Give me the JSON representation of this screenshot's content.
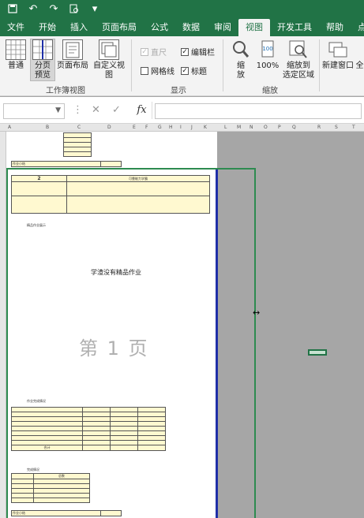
{
  "titlebar": {
    "save_icon": "save-icon",
    "undo_icon": "undo-icon",
    "redo_icon": "redo-icon",
    "preview_icon": "print-preview-icon",
    "customize": "▾"
  },
  "tabs": [
    "文件",
    "开始",
    "插入",
    "页面布局",
    "公式",
    "数据",
    "审阅",
    "视图",
    "开发工具",
    "帮助",
    "点"
  ],
  "active_tab": "视图",
  "ribbon": {
    "workbook_views": {
      "normal": "普通",
      "page_break_line1": "分页",
      "page_break_line2": "预览",
      "page_layout": "页面布局",
      "custom_view": "自定义视图",
      "group_label": "工作簿视图"
    },
    "show": {
      "ruler": "直尺",
      "formula_bar": "编辑栏",
      "gridlines": "网格线",
      "headings": "标题",
      "group_label": "显示"
    },
    "zoom": {
      "zoom_line1": "缩",
      "zoom_line2": "放",
      "zoom_100": "100%",
      "zoom_sel_line1": "缩放到",
      "zoom_sel_line2": "选定区域",
      "group_label": "缩放"
    },
    "window": {
      "new_window": "新建窗口",
      "all": "全"
    }
  },
  "formula_bar": {
    "name_box": "",
    "cancel": "✕",
    "enter": "✓",
    "fx": "fx",
    "value": ""
  },
  "columns": [
    "A",
    "B",
    "C",
    "D",
    "E",
    "F",
    "G",
    "H",
    "I",
    "J",
    "K",
    "L",
    "M",
    "N",
    "O",
    "P",
    "Q",
    "R",
    "S",
    "T"
  ],
  "sheet": {
    "watermark": "第 1 页",
    "doc_title": "学渣没有精品作业",
    "page_number": "2",
    "subtitle": "可靠能力学霸",
    "section1": "精品作业展示",
    "section2": "作业完成情况",
    "section3": "完成情况",
    "total_label": "合计",
    "count_label": "总数",
    "status_label": "作业小结"
  }
}
